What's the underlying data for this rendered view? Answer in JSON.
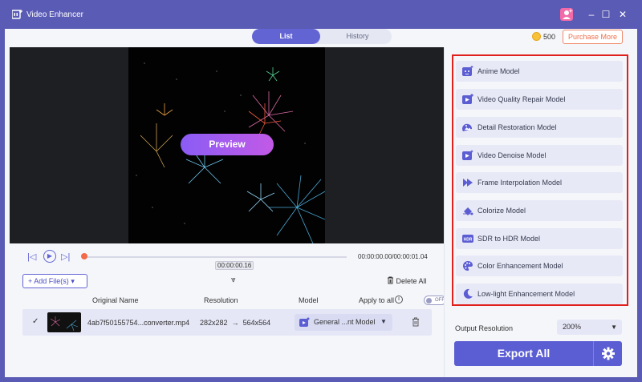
{
  "app": {
    "title": "Video Enhancer"
  },
  "window_controls": {
    "user_icon": "user-badge-icon",
    "minimize": "–",
    "maximize": "☐",
    "close": "✕"
  },
  "tabs": [
    {
      "label": "List",
      "active": true
    },
    {
      "label": "History",
      "active": false
    }
  ],
  "account": {
    "coins": "500",
    "purchase_label": "Purchase More"
  },
  "preview": {
    "button_label": "Preview"
  },
  "player": {
    "current_time": "00:00:00.16",
    "time_readout": "00:00:00.00/00:00:01.04"
  },
  "file_list": {
    "add_files_label": "Add File(s)",
    "delete_all_label": "Delete All",
    "headers": {
      "original_name": "Original Name",
      "resolution": "Resolution",
      "model": "Model",
      "apply_to_all": "Apply to all"
    },
    "apply_toggle": "OFF",
    "rows": [
      {
        "name": "4ab7f50155754...converter.mp4",
        "resolution_from": "282x282",
        "resolution_to": "564x564",
        "model": "General ...nt Model",
        "checked": true
      }
    ]
  },
  "models": [
    {
      "label": "Anime Model",
      "icon": "anime-icon"
    },
    {
      "label": "Video Quality Repair Model",
      "icon": "video-play-icon"
    },
    {
      "label": "Detail Restoration Model",
      "icon": "image-restore-icon"
    },
    {
      "label": "Video Denoise Model",
      "icon": "denoise-icon"
    },
    {
      "label": "Frame Interpolation Model",
      "icon": "fast-forward-icon"
    },
    {
      "label": "Colorize Model",
      "icon": "paint-bucket-icon"
    },
    {
      "label": "SDR to HDR Model",
      "icon": "hdr-icon"
    },
    {
      "label": "Color Enhancement Model",
      "icon": "palette-icon"
    },
    {
      "label": "Low-light Enhancement Model",
      "icon": "moon-icon"
    }
  ],
  "output": {
    "resolution_label": "Output Resolution",
    "resolution_value": "200%"
  },
  "export": {
    "label": "Export All"
  },
  "colors": {
    "accent": "#5b5dd3",
    "titlebar": "#5a5bb5",
    "highlight": "#e0201d",
    "purchase": "#ef6f4c"
  }
}
